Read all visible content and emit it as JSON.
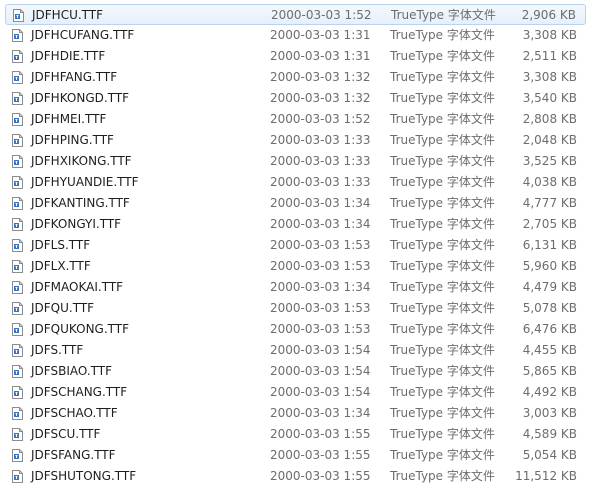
{
  "files": [
    {
      "name": "JDFHCU.TTF",
      "date": "2000-03-03 1:52",
      "type": "TrueType 字体文件",
      "size": "2,906 KB",
      "icon": "font-file-icon",
      "selected": true
    },
    {
      "name": "JDFHCUFANG.TTF",
      "date": "2000-03-03 1:31",
      "type": "TrueType 字体文件",
      "size": "3,308 KB",
      "icon": "font-file-icon"
    },
    {
      "name": "JDFHDIE.TTF",
      "date": "2000-03-03 1:31",
      "type": "TrueType 字体文件",
      "size": "2,511 KB",
      "icon": "font-file-icon"
    },
    {
      "name": "JDFHFANG.TTF",
      "date": "2000-03-03 1:32",
      "type": "TrueType 字体文件",
      "size": "3,308 KB",
      "icon": "font-file-icon"
    },
    {
      "name": "JDFHKONGD.TTF",
      "date": "2000-03-03 1:32",
      "type": "TrueType 字体文件",
      "size": "3,540 KB",
      "icon": "font-file-icon"
    },
    {
      "name": "JDFHMEI.TTF",
      "date": "2000-03-03 1:52",
      "type": "TrueType 字体文件",
      "size": "2,808 KB",
      "icon": "font-file-icon"
    },
    {
      "name": "JDFHPING.TTF",
      "date": "2000-03-03 1:33",
      "type": "TrueType 字体文件",
      "size": "2,048 KB",
      "icon": "font-file-icon"
    },
    {
      "name": "JDFHXIKONG.TTF",
      "date": "2000-03-03 1:33",
      "type": "TrueType 字体文件",
      "size": "3,525 KB",
      "icon": "font-file-icon"
    },
    {
      "name": "JDFHYUANDIE.TTF",
      "date": "2000-03-03 1:33",
      "type": "TrueType 字体文件",
      "size": "4,038 KB",
      "icon": "font-file-icon"
    },
    {
      "name": "JDFKANTING.TTF",
      "date": "2000-03-03 1:34",
      "type": "TrueType 字体文件",
      "size": "4,777 KB",
      "icon": "font-file-icon"
    },
    {
      "name": "JDFKONGYI.TTF",
      "date": "2000-03-03 1:34",
      "type": "TrueType 字体文件",
      "size": "2,705 KB",
      "icon": "font-file-icon"
    },
    {
      "name": "JDFLS.TTF",
      "date": "2000-03-03 1:53",
      "type": "TrueType 字体文件",
      "size": "6,131 KB",
      "icon": "font-file-icon"
    },
    {
      "name": "JDFLX.TTF",
      "date": "2000-03-03 1:53",
      "type": "TrueType 字体文件",
      "size": "5,960 KB",
      "icon": "font-file-icon"
    },
    {
      "name": "JDFMAOKAI.TTF",
      "date": "2000-03-03 1:34",
      "type": "TrueType 字体文件",
      "size": "4,479 KB",
      "icon": "font-file-icon"
    },
    {
      "name": "JDFQU.TTF",
      "date": "2000-03-03 1:53",
      "type": "TrueType 字体文件",
      "size": "5,078 KB",
      "icon": "font-file-icon"
    },
    {
      "name": "JDFQUKONG.TTF",
      "date": "2000-03-03 1:53",
      "type": "TrueType 字体文件",
      "size": "6,476 KB",
      "icon": "font-file-icon"
    },
    {
      "name": "JDFS.TTF",
      "date": "2000-03-03 1:54",
      "type": "TrueType 字体文件",
      "size": "4,455 KB",
      "icon": "font-file-icon"
    },
    {
      "name": "JDFSBIAO.TTF",
      "date": "2000-03-03 1:54",
      "type": "TrueType 字体文件",
      "size": "5,865 KB",
      "icon": "font-file-icon"
    },
    {
      "name": "JDFSCHANG.TTF",
      "date": "2000-03-03 1:54",
      "type": "TrueType 字体文件",
      "size": "4,492 KB",
      "icon": "font-file-icon"
    },
    {
      "name": "JDFSCHAO.TTF",
      "date": "2000-03-03 1:34",
      "type": "TrueType 字体文件",
      "size": "3,003 KB",
      "icon": "font-file-icon"
    },
    {
      "name": "JDFSCU.TTF",
      "date": "2000-03-03 1:55",
      "type": "TrueType 字体文件",
      "size": "4,589 KB",
      "icon": "font-file-icon"
    },
    {
      "name": "JDFSFANG.TTF",
      "date": "2000-03-03 1:55",
      "type": "TrueType 字体文件",
      "size": "5,054 KB",
      "icon": "font-file-icon"
    },
    {
      "name": "JDFSHUTONG.TTF",
      "date": "2000-03-03 1:55",
      "type": "TrueType 字体文件",
      "size": "11,512 KB",
      "icon": "font-file-icon"
    }
  ],
  "colors": {
    "selection_background": "#e6f0fb",
    "selection_border": "#b9d3ef",
    "primary_text": "#1e1e1e",
    "secondary_text": "#6d6d6d",
    "icon_badge": "#3b73c4"
  }
}
